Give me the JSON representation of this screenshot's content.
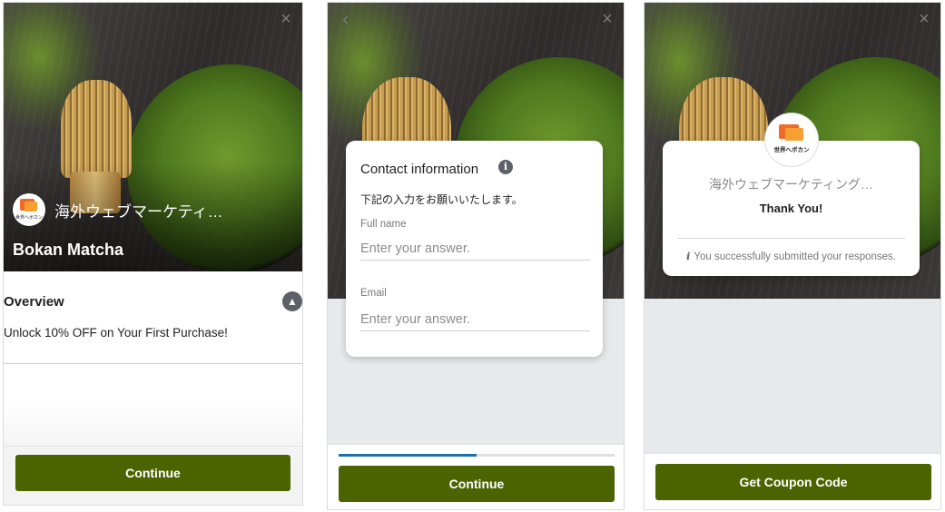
{
  "screen1": {
    "brand_name": "海外ウェブマーケティ…",
    "logo_text": "世界へボカン",
    "product_name": "Bokan Matcha",
    "overview_title": "Overview",
    "overview_text": "Unlock 10% OFF on Your First Purchase!",
    "continue_label": "Continue",
    "close_icon": "×",
    "collapse_icon": "▲"
  },
  "screen2": {
    "back_icon": "‹",
    "close_icon": "×",
    "card_title": "Contact information",
    "info_icon": "i",
    "card_subtitle": "下記の入力をお願いいたします。",
    "full_name_label": "Full name",
    "full_name_placeholder": "Enter your answer.",
    "email_label": "Email",
    "email_placeholder": "Enter your answer.",
    "progress": 0.5,
    "continue_label": "Continue"
  },
  "screen3": {
    "close_icon": "×",
    "logo_text": "世界へボカン",
    "brand_name": "海外ウェブマーケティング…",
    "thank_you": "Thank You!",
    "success_icon": "i",
    "success_message": "You successfully submitted your responses.",
    "coupon_label": "Get Coupon Code"
  },
  "colors": {
    "primary_button": "#4c6400",
    "progress": "#1f6fb0",
    "logo_orange": "#f06a2a",
    "logo_yellow": "#f7a032"
  }
}
